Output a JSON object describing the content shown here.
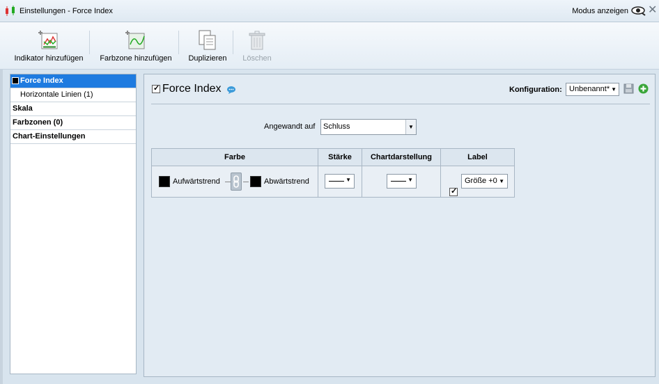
{
  "window": {
    "title": "Einstellungen - Force Index",
    "mode_label": "Modus anzeigen"
  },
  "toolbar": {
    "add_indicator": "Indikator hinzufügen",
    "add_colorzone": "Farbzone hinzufügen",
    "duplicate": "Duplizieren",
    "delete": "Löschen"
  },
  "sidebar": {
    "items": [
      {
        "label": "Force Index",
        "selected": true
      },
      {
        "label": "Horizontale Linien (1)",
        "sub": true
      },
      {
        "label": "Skala"
      },
      {
        "label": "Farbzonen (0)"
      },
      {
        "label": "Chart-Einstellungen"
      }
    ]
  },
  "main": {
    "indicator_title": "Force Index",
    "indicator_enabled": true,
    "config_label": "Konfiguration:",
    "config_value": "Unbenannt*",
    "applied_label": "Angewandt auf",
    "applied_value": "Schluss",
    "table": {
      "headers": [
        "Farbe",
        "Stärke",
        "Chartdarstellung",
        "Label"
      ],
      "up_label": "Aufwärtstrend",
      "down_label": "Abwärtstrend",
      "up_color": "#000000",
      "down_color": "#000000",
      "label_checked": true,
      "size_value": "Größe +0"
    }
  },
  "colors": {
    "selection": "#1e7be0",
    "add_green": "#3aa63a",
    "info_blue": "#3a9ad9"
  }
}
